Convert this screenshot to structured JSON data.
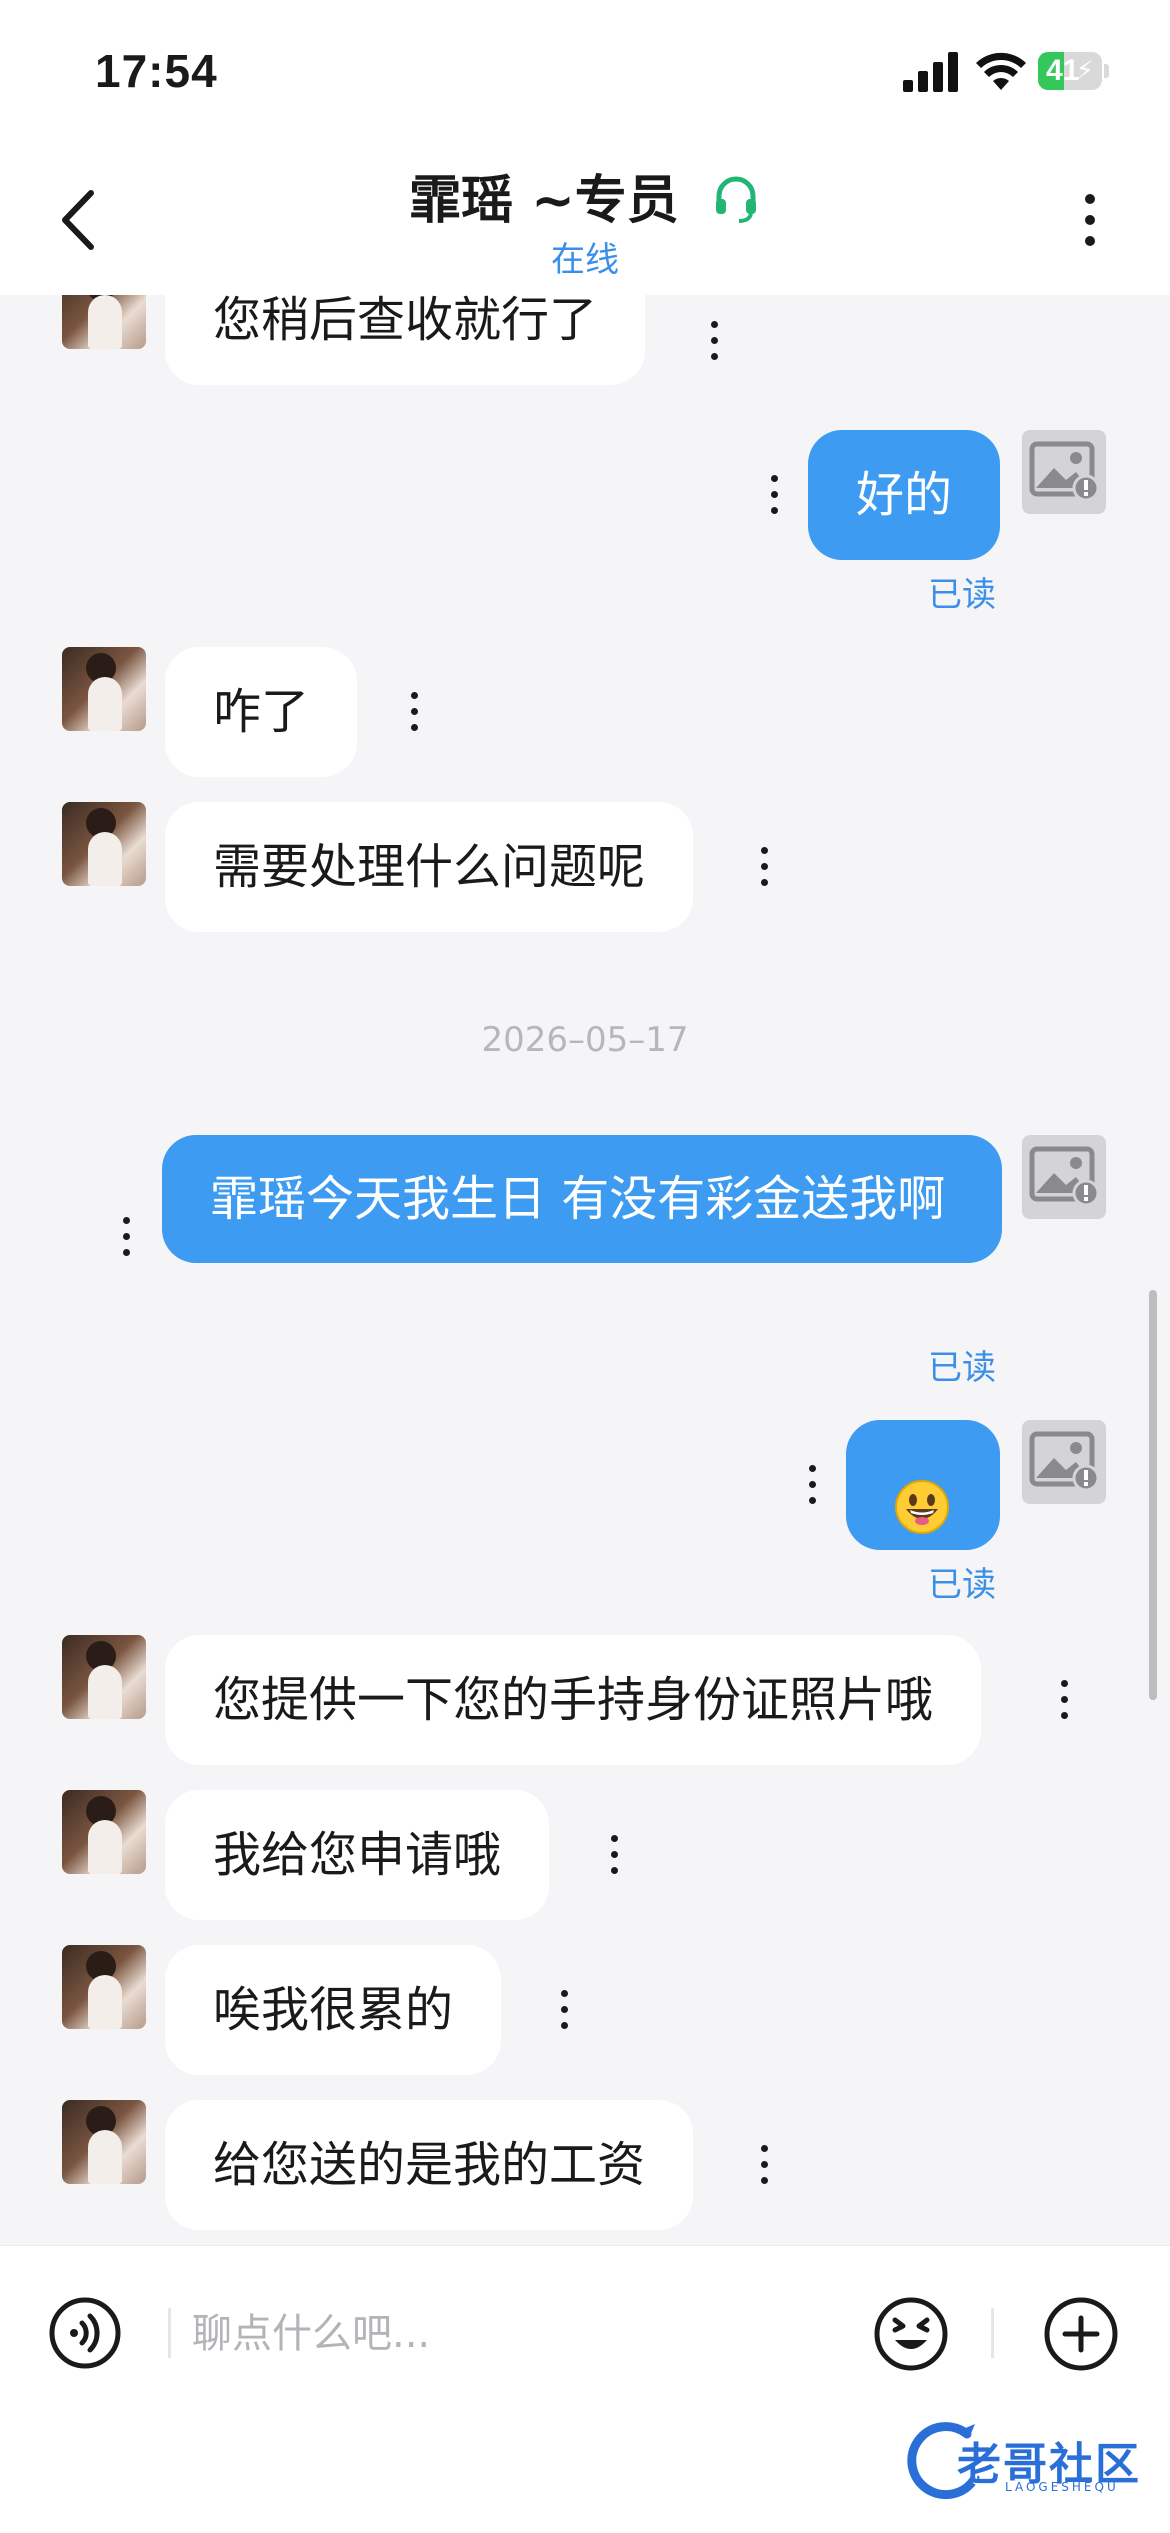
{
  "status": {
    "time": "17:54",
    "battery": "41",
    "battery_level": 0.41
  },
  "header": {
    "title": "霏瑶 ~专员",
    "status": "在线"
  },
  "messages": {
    "m1": "您稍后查收就行了",
    "m2": "好的",
    "m2_read": "已读",
    "m3": "咋了",
    "m4": "需要处理什么问题呢",
    "date": "2026–05–17",
    "m5": "霏瑶今天我生日 有没有彩金送我啊",
    "m5_read": "已读",
    "m6_read": "已读",
    "m7": "您提供一下您的手持身份证照片哦",
    "m8": "我给您申请哦",
    "m9": "唉我很累的",
    "m10": "给您送的是我的工资"
  },
  "input": {
    "placeholder": "聊点什么吧..."
  },
  "watermark": {
    "text": "老哥社区",
    "sub": "LAOGESHEQU"
  },
  "colors": {
    "accent": "#3d9bf2",
    "link": "#3b8fe8",
    "online_icon": "#22b573"
  }
}
